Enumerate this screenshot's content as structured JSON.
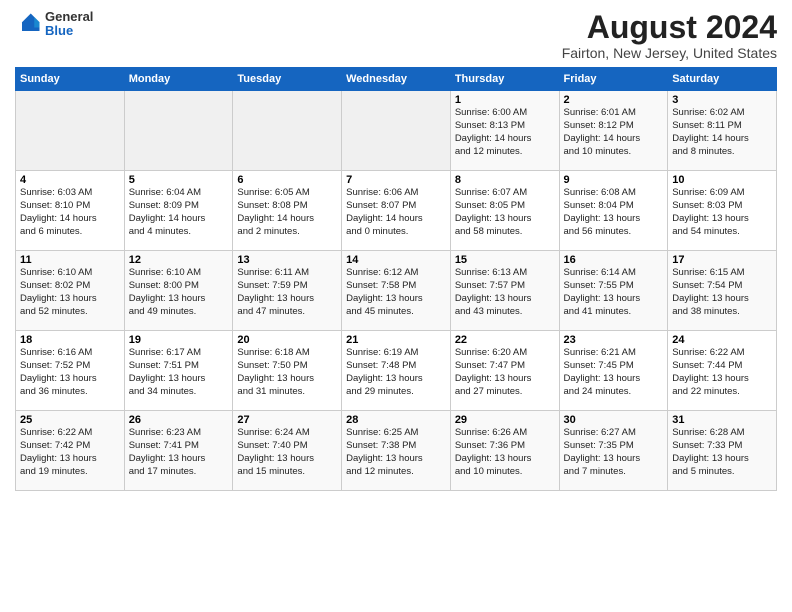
{
  "logo": {
    "general": "General",
    "blue": "Blue"
  },
  "title": "August 2024",
  "subtitle": "Fairton, New Jersey, United States",
  "days_header": [
    "Sunday",
    "Monday",
    "Tuesday",
    "Wednesday",
    "Thursday",
    "Friday",
    "Saturday"
  ],
  "weeks": [
    [
      {
        "day": "",
        "info": ""
      },
      {
        "day": "",
        "info": ""
      },
      {
        "day": "",
        "info": ""
      },
      {
        "day": "",
        "info": ""
      },
      {
        "day": "1",
        "info": "Sunrise: 6:00 AM\nSunset: 8:13 PM\nDaylight: 14 hours\nand 12 minutes."
      },
      {
        "day": "2",
        "info": "Sunrise: 6:01 AM\nSunset: 8:12 PM\nDaylight: 14 hours\nand 10 minutes."
      },
      {
        "day": "3",
        "info": "Sunrise: 6:02 AM\nSunset: 8:11 PM\nDaylight: 14 hours\nand 8 minutes."
      }
    ],
    [
      {
        "day": "4",
        "info": "Sunrise: 6:03 AM\nSunset: 8:10 PM\nDaylight: 14 hours\nand 6 minutes."
      },
      {
        "day": "5",
        "info": "Sunrise: 6:04 AM\nSunset: 8:09 PM\nDaylight: 14 hours\nand 4 minutes."
      },
      {
        "day": "6",
        "info": "Sunrise: 6:05 AM\nSunset: 8:08 PM\nDaylight: 14 hours\nand 2 minutes."
      },
      {
        "day": "7",
        "info": "Sunrise: 6:06 AM\nSunset: 8:07 PM\nDaylight: 14 hours\nand 0 minutes."
      },
      {
        "day": "8",
        "info": "Sunrise: 6:07 AM\nSunset: 8:05 PM\nDaylight: 13 hours\nand 58 minutes."
      },
      {
        "day": "9",
        "info": "Sunrise: 6:08 AM\nSunset: 8:04 PM\nDaylight: 13 hours\nand 56 minutes."
      },
      {
        "day": "10",
        "info": "Sunrise: 6:09 AM\nSunset: 8:03 PM\nDaylight: 13 hours\nand 54 minutes."
      }
    ],
    [
      {
        "day": "11",
        "info": "Sunrise: 6:10 AM\nSunset: 8:02 PM\nDaylight: 13 hours\nand 52 minutes."
      },
      {
        "day": "12",
        "info": "Sunrise: 6:10 AM\nSunset: 8:00 PM\nDaylight: 13 hours\nand 49 minutes."
      },
      {
        "day": "13",
        "info": "Sunrise: 6:11 AM\nSunset: 7:59 PM\nDaylight: 13 hours\nand 47 minutes."
      },
      {
        "day": "14",
        "info": "Sunrise: 6:12 AM\nSunset: 7:58 PM\nDaylight: 13 hours\nand 45 minutes."
      },
      {
        "day": "15",
        "info": "Sunrise: 6:13 AM\nSunset: 7:57 PM\nDaylight: 13 hours\nand 43 minutes."
      },
      {
        "day": "16",
        "info": "Sunrise: 6:14 AM\nSunset: 7:55 PM\nDaylight: 13 hours\nand 41 minutes."
      },
      {
        "day": "17",
        "info": "Sunrise: 6:15 AM\nSunset: 7:54 PM\nDaylight: 13 hours\nand 38 minutes."
      }
    ],
    [
      {
        "day": "18",
        "info": "Sunrise: 6:16 AM\nSunset: 7:52 PM\nDaylight: 13 hours\nand 36 minutes."
      },
      {
        "day": "19",
        "info": "Sunrise: 6:17 AM\nSunset: 7:51 PM\nDaylight: 13 hours\nand 34 minutes."
      },
      {
        "day": "20",
        "info": "Sunrise: 6:18 AM\nSunset: 7:50 PM\nDaylight: 13 hours\nand 31 minutes."
      },
      {
        "day": "21",
        "info": "Sunrise: 6:19 AM\nSunset: 7:48 PM\nDaylight: 13 hours\nand 29 minutes."
      },
      {
        "day": "22",
        "info": "Sunrise: 6:20 AM\nSunset: 7:47 PM\nDaylight: 13 hours\nand 27 minutes."
      },
      {
        "day": "23",
        "info": "Sunrise: 6:21 AM\nSunset: 7:45 PM\nDaylight: 13 hours\nand 24 minutes."
      },
      {
        "day": "24",
        "info": "Sunrise: 6:22 AM\nSunset: 7:44 PM\nDaylight: 13 hours\nand 22 minutes."
      }
    ],
    [
      {
        "day": "25",
        "info": "Sunrise: 6:22 AM\nSunset: 7:42 PM\nDaylight: 13 hours\nand 19 minutes."
      },
      {
        "day": "26",
        "info": "Sunrise: 6:23 AM\nSunset: 7:41 PM\nDaylight: 13 hours\nand 17 minutes."
      },
      {
        "day": "27",
        "info": "Sunrise: 6:24 AM\nSunset: 7:40 PM\nDaylight: 13 hours\nand 15 minutes."
      },
      {
        "day": "28",
        "info": "Sunrise: 6:25 AM\nSunset: 7:38 PM\nDaylight: 13 hours\nand 12 minutes."
      },
      {
        "day": "29",
        "info": "Sunrise: 6:26 AM\nSunset: 7:36 PM\nDaylight: 13 hours\nand 10 minutes."
      },
      {
        "day": "30",
        "info": "Sunrise: 6:27 AM\nSunset: 7:35 PM\nDaylight: 13 hours\nand 7 minutes."
      },
      {
        "day": "31",
        "info": "Sunrise: 6:28 AM\nSunset: 7:33 PM\nDaylight: 13 hours\nand 5 minutes."
      }
    ]
  ]
}
